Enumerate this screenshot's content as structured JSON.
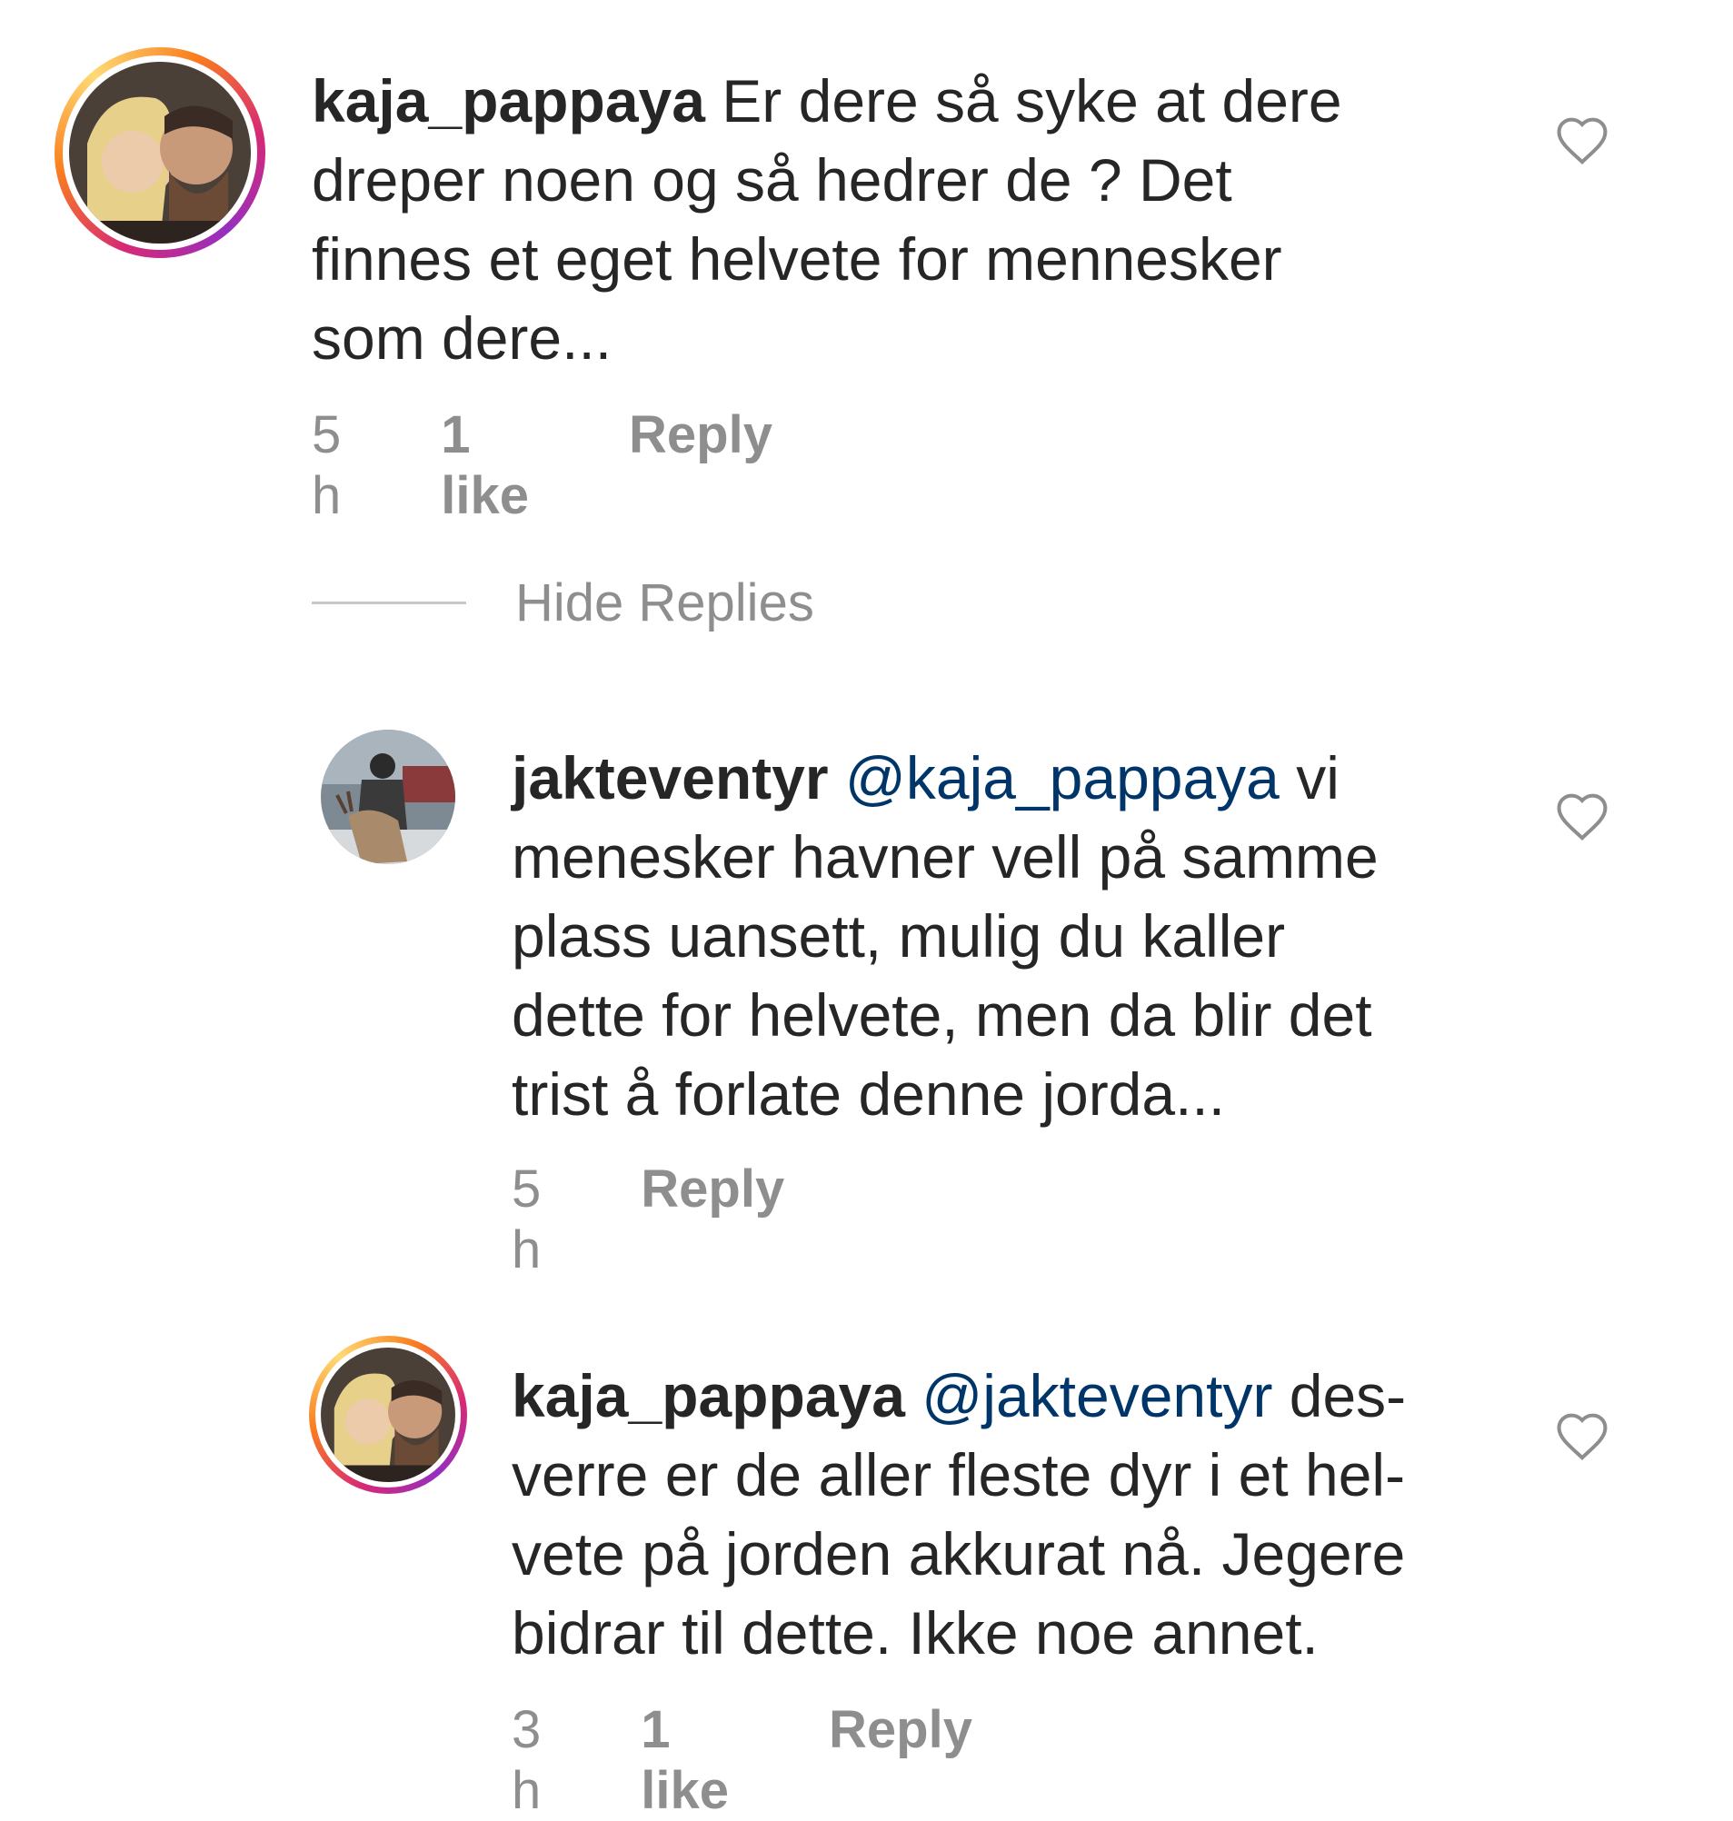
{
  "comments": [
    {
      "username": "kaja_pappaya",
      "mention": "",
      "text": "Er dere så syke at dere dreper noen og så hedrer de ? Det finnes et eget helvete for mennesker som dere...",
      "lines": [
        "Er dere så syke at dere",
        "dreper noen og så hedrer de ? Det",
        "finnes et eget helvete for mennesker",
        "som dere..."
      ],
      "time": "5 h",
      "likes": "1 like",
      "reply": "Reply",
      "avatar": "couple-photo",
      "story_ring": true
    }
  ],
  "replies_toggle": "Hide Replies",
  "replies": [
    {
      "username": "jakteventyr",
      "mention": "@kaja_pappaya",
      "lines": [
        "vi",
        "menesker havner vell på samme",
        "plass uansett, mulig du kaller",
        "dette for helvete, men da blir det",
        "trist å forlate denne jorda..."
      ],
      "time": "5 h",
      "likes": "",
      "reply": "Reply",
      "avatar": "hunter-photo",
      "story_ring": false
    },
    {
      "username": "kaja_pappaya",
      "mention": "@jakteventyr",
      "lines": [
        "des-",
        "verre er de aller fleste dyr i et hel-",
        "vete på jorden akkurat nå. Jegere",
        "bidrar til dette. Ikke noe annet."
      ],
      "time": "3 h",
      "likes": "1 like",
      "reply": "Reply",
      "avatar": "couple-photo",
      "story_ring": true
    }
  ],
  "colors": {
    "text": "#262626",
    "secondary": "#8e8e8e",
    "mention": "#003569",
    "ring_start": "#d62976",
    "ring_end": "#fa7e1e"
  },
  "icons": {
    "like": "heart-outline-icon"
  }
}
